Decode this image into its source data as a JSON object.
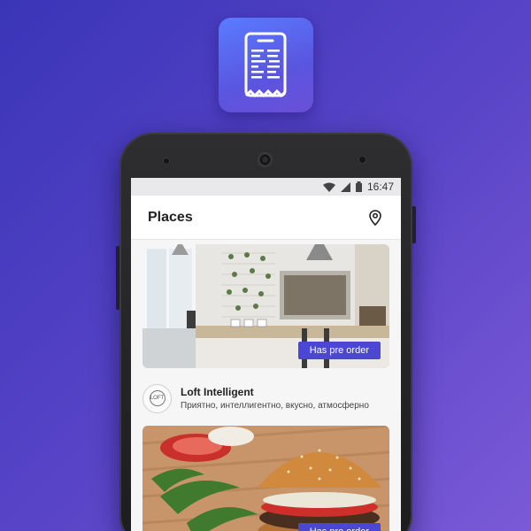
{
  "status_bar": {
    "time": "16:47"
  },
  "app_bar": {
    "title": "Places",
    "action_icon": "location-pin-icon"
  },
  "places": [
    {
      "name": "Loft Intelligent",
      "description": "Приятно, интеллигентно, вкусно, атмосферно",
      "logo_text": "LOFT",
      "badge": "Has pre order"
    },
    {
      "badge": "Has pre order"
    }
  ],
  "colors": {
    "accent": "#4b47d2",
    "background_start": "#3a35b8",
    "background_end": "#7b5ad6"
  }
}
